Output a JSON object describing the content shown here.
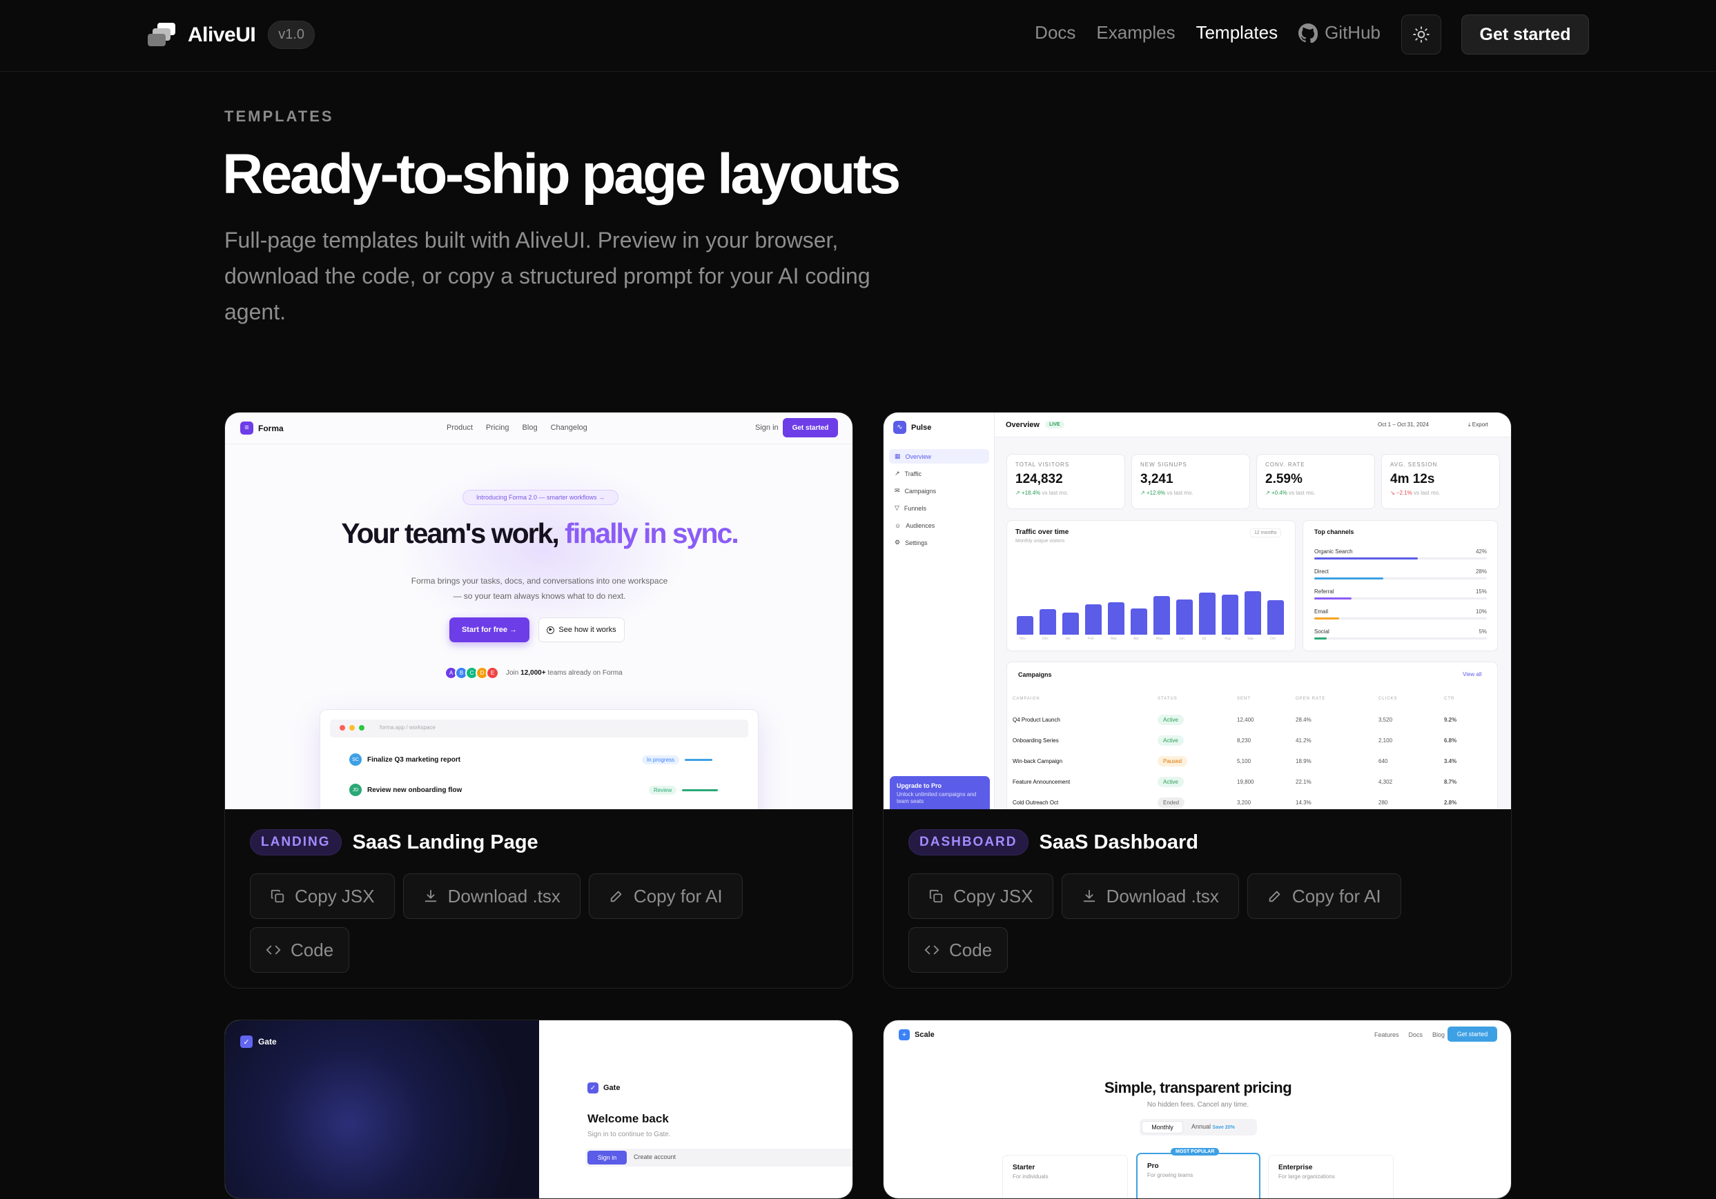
{
  "nav": {
    "brand": "AliveUI",
    "version": "v1.0",
    "links": [
      "Docs",
      "Examples",
      "Templates"
    ],
    "github": "GitHub",
    "cta": "Get started"
  },
  "hero": {
    "eyebrow": "TEMPLATES",
    "title": "Ready-to-ship page layouts",
    "lead": "Full-page templates built with AliveUI. Preview in your browser, download the code, or copy a structured prompt for your AI coding agent."
  },
  "buttons": {
    "copy_jsx": "Copy JSX",
    "download": "Download .tsx",
    "copy_ai": "Copy for AI",
    "code": "Code"
  },
  "cards": [
    {
      "tag": "LANDING",
      "title": "SaaS Landing Page"
    },
    {
      "tag": "DASHBOARD",
      "title": "SaaS Dashboard"
    }
  ],
  "landing": {
    "brand": "Forma",
    "nav": [
      "Product",
      "Pricing",
      "Blog",
      "Changelog"
    ],
    "signin": "Sign in",
    "cta": "Get started",
    "badge": "Introducing Forma 2.0 — smarter workflows →",
    "h_dark": "Your team's work,",
    "h_accent": "finally in sync.",
    "sub1": "Forma brings your tasks, docs, and conversations into one workspace",
    "sub2": "— so your team always knows what to do next.",
    "primary": "Start for free →",
    "secondary": "See how it works",
    "avatars": [
      "A",
      "B",
      "C",
      "D",
      "E"
    ],
    "social_pre": "Join",
    "social_count": "12,000+",
    "social_post": "teams already on Forma",
    "app_url": "forma.app / workspace",
    "tasks": [
      {
        "initials": "SC",
        "text": "Finalize Q3 marketing report",
        "status": "In progress"
      },
      {
        "initials": "JD",
        "text": "Review new onboarding flow",
        "status": "Review"
      }
    ]
  },
  "dashboard": {
    "brand": "Pulse",
    "title": "Overview",
    "live": "LIVE",
    "range": "Oct 1 – Oct 31, 2024",
    "export": "Export",
    "side": [
      "Overview",
      "Traffic",
      "Campaigns",
      "Funnels",
      "Audiences",
      "Settings"
    ],
    "upgrade_title": "Upgrade to Pro",
    "upgrade_sub": "Unlock unlimited campaigns and team seats",
    "kpis": [
      {
        "label": "TOTAL VISITORS",
        "value": "124,832",
        "delta": "+18.4%",
        "note": "vs last mo."
      },
      {
        "label": "NEW SIGNUPS",
        "value": "3,241",
        "delta": "+12.6%",
        "note": "vs last mo."
      },
      {
        "label": "CONV. RATE",
        "value": "2.59%",
        "delta": "+0.4%",
        "note": "vs last mo."
      },
      {
        "label": "AVG. SESSION",
        "value": "4m 12s",
        "delta": "−2.1%",
        "note": "vs last mo."
      }
    ],
    "traffic_title": "Traffic over time",
    "traffic_sub": "Monthly unique visitors",
    "traffic_range": "12 months",
    "months": [
      "Nov",
      "Dec",
      "Jan",
      "Feb",
      "Mar",
      "Apr",
      "May",
      "Jun",
      "Jul",
      "Aug",
      "Sep",
      "Oct"
    ],
    "traffic_levels": [
      0.42,
      0.58,
      0.5,
      0.68,
      0.74,
      0.6,
      0.88,
      0.8,
      0.95,
      0.9,
      0.98,
      0.78
    ],
    "channels_title": "Top channels",
    "channels": [
      {
        "name": "Organic Search",
        "pct": "42%",
        "share": 0.42,
        "color": "#5b5ce8"
      },
      {
        "name": "Direct",
        "pct": "28%",
        "share": 0.28,
        "color": "#3ea0e4"
      },
      {
        "name": "Referral",
        "pct": "15%",
        "share": 0.15,
        "color": "#8b5cf6"
      },
      {
        "name": "Email",
        "pct": "10%",
        "share": 0.1,
        "color": "#f5a524"
      },
      {
        "name": "Social",
        "pct": "5%",
        "share": 0.05,
        "color": "#2aa876"
      }
    ],
    "campaigns_title": "Campaigns",
    "view_all": "View all",
    "columns": [
      "CAMPAIGN",
      "STATUS",
      "SENT",
      "OPEN RATE",
      "CLICKS",
      "CTR"
    ],
    "rows": [
      [
        "Q4 Product Launch",
        "Active",
        "12,400",
        "28.4%",
        "3,520",
        "9.2%"
      ],
      [
        "Onboarding Series",
        "Active",
        "8,230",
        "41.2%",
        "2,100",
        "6.8%"
      ],
      [
        "Win-back Campaign",
        "Paused",
        "5,100",
        "18.9%",
        "640",
        "3.4%"
      ],
      [
        "Feature Announcement",
        "Active",
        "19,800",
        "22.1%",
        "4,302",
        "8.7%"
      ],
      [
        "Cold Outreach Oct",
        "Ended",
        "3,200",
        "14.3%",
        "280",
        "2.8%"
      ]
    ]
  },
  "gate": {
    "brand": "Gate",
    "welcome": "Welcome back",
    "sub": "Sign in to continue to Gate.",
    "tab_signin": "Sign in",
    "tab_create": "Create account"
  },
  "pricing": {
    "brand": "Scale",
    "nav": [
      "Features",
      "Docs",
      "Blog"
    ],
    "cta": "Get started",
    "title": "Simple, transparent pricing",
    "sub": "No hidden fees. Cancel any time.",
    "monthly": "Monthly",
    "annual": "Annual",
    "save": "Save 20%",
    "plans": [
      {
        "name": "Starter",
        "desc": "For individuals"
      },
      {
        "name": "Pro",
        "desc": "For growing teams",
        "badge": "MOST POPULAR"
      },
      {
        "name": "Enterprise",
        "desc": "For large organizations"
      }
    ]
  }
}
